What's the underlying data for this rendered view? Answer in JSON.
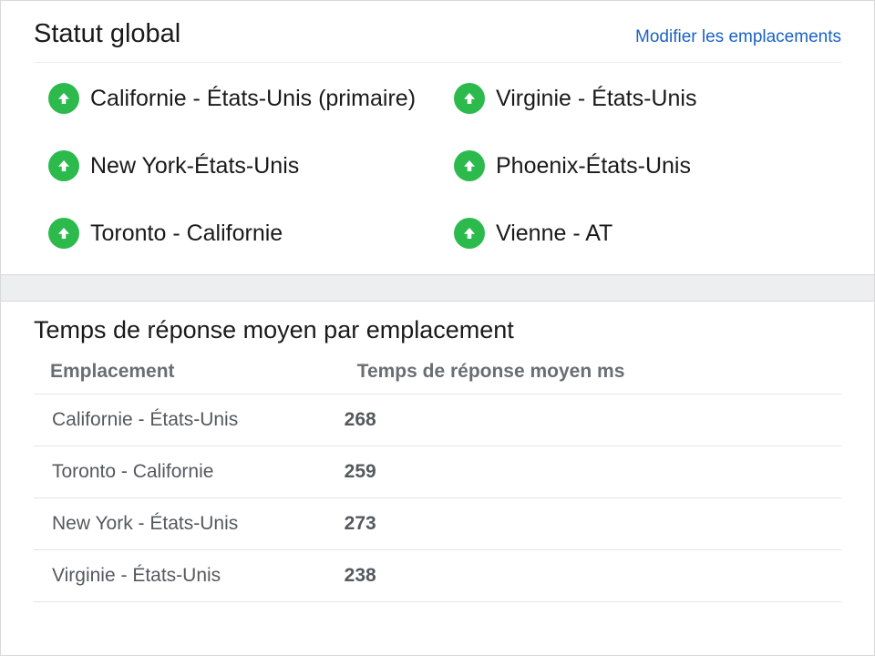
{
  "status_panel": {
    "title": "Statut global",
    "edit_link": "Modifier les emplacements",
    "locations": [
      {
        "name": "Californie - États-Unis (primaire)",
        "state": "up"
      },
      {
        "name": "Virginie - États-Unis",
        "state": "up"
      },
      {
        "name": "New York-États-Unis",
        "state": "up"
      },
      {
        "name": "Phoenix-États-Unis",
        "state": "up"
      },
      {
        "name": "Toronto - Californie",
        "state": "up"
      },
      {
        "name": "Vienne - AT",
        "state": "up"
      }
    ]
  },
  "table_panel": {
    "title": "Temps de réponse moyen par emplacement",
    "columns": {
      "location": "Emplacement",
      "avg_ms": "Temps de réponse moyen ms"
    },
    "rows": [
      {
        "location": "Californie - États-Unis",
        "avg_ms": "268"
      },
      {
        "location": "Toronto - Californie",
        "avg_ms": "259"
      },
      {
        "location": "New York - États-Unis",
        "avg_ms": "273"
      },
      {
        "location": "Virginie - États-Unis",
        "avg_ms": "238"
      }
    ]
  },
  "colors": {
    "up_icon_bg": "#2cba4d",
    "link": "#1a62c6"
  }
}
